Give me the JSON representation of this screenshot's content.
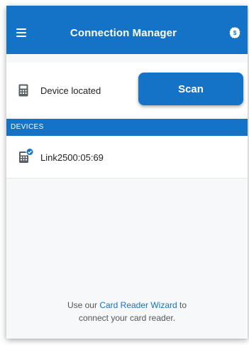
{
  "header": {
    "title": "Connection Manager",
    "menu_icon": "hamburger-menu-icon",
    "settings_icon": "gear-dollar-icon"
  },
  "status": {
    "text": "Device located",
    "icon": "card-reader-icon",
    "scan_label": "Scan"
  },
  "devices": {
    "header": "DEVICES",
    "items": [
      {
        "name": "Link2500:05:69",
        "icon": "card-reader-connected-icon"
      }
    ]
  },
  "footer": {
    "prefix": "Use our ",
    "link": "Card Reader Wizard",
    "suffix": " to",
    "line2": "connect your card reader."
  },
  "colors": {
    "brand": "#1473c7",
    "background": "#f7f8f9"
  }
}
